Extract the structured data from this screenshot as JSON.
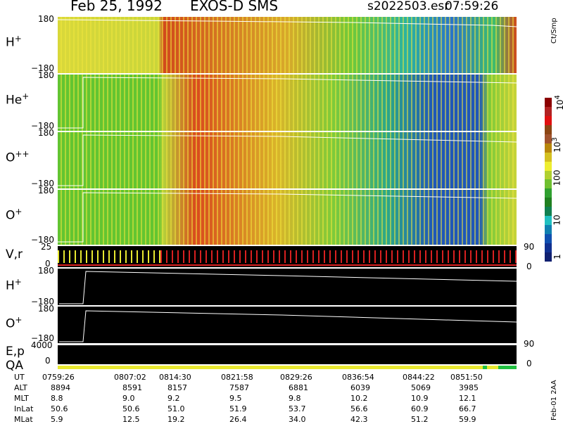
{
  "header": {
    "date": "Feb 25, 1992",
    "instrument": "EXOS-D SMS",
    "file": "s2022503.esr",
    "time": "07:59:26"
  },
  "panels": [
    {
      "label": "H",
      "charge": "+",
      "top_tick": "180",
      "bottom_tick": "−180"
    },
    {
      "label": "He",
      "charge": "+",
      "top_tick": "180",
      "bottom_tick": "−180"
    },
    {
      "label": "O",
      "charge": "++",
      "top_tick": "180",
      "bottom_tick": "−180"
    },
    {
      "label": "O",
      "charge": "+",
      "top_tick": "180",
      "bottom_tick": "−180"
    }
  ],
  "vr_panel": {
    "label": "V,r",
    "top_tick": "25",
    "bottom_tick": "0",
    "right_top": "90",
    "right_bottom": "0"
  },
  "line_panels": [
    {
      "label": "H",
      "charge": "+",
      "top_tick": "180",
      "bottom_tick": "−180"
    },
    {
      "label": "O",
      "charge": "+",
      "top_tick": "180",
      "bottom_tick": "−180"
    }
  ],
  "ep_panel": {
    "label": "E,p",
    "tick": "4000",
    "right_top": "90"
  },
  "qa_panel": {
    "label": "QA",
    "tick": "0",
    "right_bottom": "0"
  },
  "colorbar": {
    "unit": "Ct/Smp",
    "ticks": [
      "10",
      "100",
      "10",
      "10",
      "1"
    ],
    "ticks_sup": [
      "4",
      "",
      "3",
      "",
      ""
    ],
    "colors": [
      "#ffffff",
      "#8b0000",
      "#b22222",
      "#e01010",
      "#8b4513",
      "#a0522d",
      "#b8860b",
      "#d4c020",
      "#eeee30",
      "#b0d030",
      "#70c030",
      "#30a030",
      "#208020",
      "#108050",
      "#20c0c0",
      "#1080b0",
      "#1050b0",
      "#103090",
      "#102070"
    ]
  },
  "footer_side": "Feb-01 2AA",
  "table": {
    "row_labels": [
      "UT",
      "ALT",
      "MLT",
      "InLat",
      "MLat"
    ],
    "columns": [
      [
        "0759:26",
        "8894",
        "8.8",
        "50.6",
        "5.9"
      ],
      [
        "0807:02",
        "8591",
        "9.0",
        "50.6",
        "12.5"
      ],
      [
        "0814:30",
        "8157",
        "9.2",
        "51.0",
        "19.2"
      ],
      [
        "0821:58",
        "7587",
        "9.5",
        "51.9",
        "26.4"
      ],
      [
        "0829:26",
        "6881",
        "9.8",
        "53.7",
        "34.0"
      ],
      [
        "0836:54",
        "6039",
        "10.2",
        "56.6",
        "42.3"
      ],
      [
        "0844:22",
        "5069",
        "10.9",
        "60.9",
        "51.2"
      ],
      [
        "0851:50",
        "3985",
        "12.1",
        "66.7",
        "59.9"
      ]
    ]
  },
  "chart_data": {
    "type": "heatmap",
    "title": "Feb 25, 1992   EXOS-D SMS",
    "x": [
      "0759:26",
      "0807:02",
      "0814:30",
      "0821:58",
      "0829:26",
      "0836:54",
      "0844:22",
      "0851:50"
    ],
    "ylim": [
      -180,
      180
    ],
    "series": [
      {
        "name": "H+"
      },
      {
        "name": "He+"
      },
      {
        "name": "O++"
      },
      {
        "name": "O+"
      }
    ],
    "colorscale": "log",
    "clim": [
      1,
      10000
    ]
  }
}
